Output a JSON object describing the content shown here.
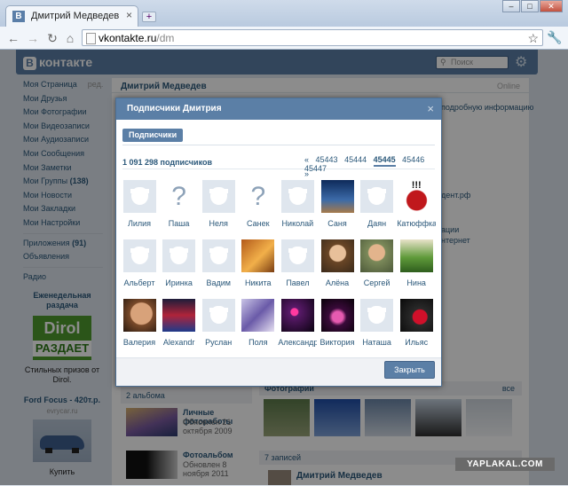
{
  "browser": {
    "tab_title": "Дмитрий Медведев",
    "tab_favicon": "В",
    "tab_close": "×",
    "new_tab": "+",
    "url_host": "vkontakte.ru",
    "url_path": "/dm",
    "window_minimize": "–",
    "window_maximize": "□",
    "window_close": "✕"
  },
  "vk": {
    "logo_badge": "В",
    "logo_text": "контакте",
    "search_placeholder": "Поиск"
  },
  "menu": {
    "items": [
      {
        "label": "Моя Страница",
        "extra": "ред."
      },
      {
        "label": "Мои Друзья"
      },
      {
        "label": "Мои Фотографии"
      },
      {
        "label": "Мои Видеозаписи"
      },
      {
        "label": "Мои Аудиозаписи"
      },
      {
        "label": "Мои Сообщения"
      },
      {
        "label": "Мои Заметки"
      },
      {
        "label": "Мои Группы",
        "count": "(138)"
      },
      {
        "label": "Мои Новости"
      },
      {
        "label": "Мои Закладки"
      },
      {
        "label": "Мои Настройки"
      }
    ],
    "apps": {
      "label": "Приложения",
      "count": "(91)"
    },
    "ads": "Объявления",
    "radio": "Радио"
  },
  "ad1": {
    "heading": "Еженедельная раздача",
    "banner_top": "Dirol",
    "banner_bottom": "РАЗДАЕТ",
    "text": "Стильных призов от Dirol."
  },
  "ad2": {
    "heading": "Ford Focus - 420т.р.",
    "site": "evrycar.ru",
    "buy": "Купить"
  },
  "profile": {
    "name": "Дмитрий Медведев",
    "status": "Online",
    "info_link": "подробную информацию",
    "site_fragment": "дент.рф",
    "right1": "ации",
    "right2": "нтернет"
  },
  "modal": {
    "title": "Подписчики Дмитрия",
    "close": "×",
    "tab": "Подписчики",
    "count": "1 091 298 подписчиков",
    "pager": {
      "prev": "«",
      "pages": [
        "45443",
        "45444",
        "45445",
        "45446",
        "45447"
      ],
      "current": "45445",
      "next": "»"
    },
    "subscribers": [
      {
        "name": "Лилия",
        "ava": "dog"
      },
      {
        "name": "Паша",
        "ava": "question"
      },
      {
        "name": "Неля",
        "ava": "dog"
      },
      {
        "name": "Санек",
        "ava": "question"
      },
      {
        "name": "Николай",
        "ava": "dog"
      },
      {
        "name": "Саня",
        "ava": "photo-blue"
      },
      {
        "name": "Даян",
        "ava": "dog"
      },
      {
        "name": "Катюффка",
        "ava": "photo-stop"
      },
      {
        "name": "Альберт",
        "ava": "dog"
      },
      {
        "name": "Иринка",
        "ava": "dog"
      },
      {
        "name": "Вадим",
        "ava": "dog"
      },
      {
        "name": "Никита",
        "ava": "photo-orange"
      },
      {
        "name": "Павел",
        "ava": "dog"
      },
      {
        "name": "Алёна",
        "ava": "photo-girl"
      },
      {
        "name": "Сергей",
        "ava": "photo-boy"
      },
      {
        "name": "Нина",
        "ava": "photo-green"
      },
      {
        "name": "Валерия",
        "ava": "photo-face"
      },
      {
        "name": "Alexandr",
        "ava": "photo-football"
      },
      {
        "name": "Руслан",
        "ava": "dog"
      },
      {
        "name": "Поля",
        "ava": "photo-purple"
      },
      {
        "name": "Александра",
        "ava": "photo-dark"
      },
      {
        "name": "Виктория",
        "ava": "photo-night"
      },
      {
        "name": "Наташа",
        "ava": "dog"
      },
      {
        "name": "Ильяс",
        "ava": "photo-bike"
      }
    ],
    "close_button": "Закрыть"
  },
  "albums": {
    "header": "2 альбома",
    "items": [
      {
        "title": "Личные фотоработы",
        "sub": "Обновлен 21 октября 2009"
      },
      {
        "title": "Фотоальбом",
        "sub": "Обновлен 8 ноября 2011"
      }
    ]
  },
  "photos": {
    "header": "Фотографии",
    "all": "все"
  },
  "posts": {
    "header": "7 записей",
    "author": "Дмитрий Медведев"
  },
  "watermark": "YAPLAKAL.COM",
  "colors": {
    "vk_blue": "#5b7fa6",
    "link": "#2b587a",
    "dirol_green": "#4f9b2f"
  }
}
